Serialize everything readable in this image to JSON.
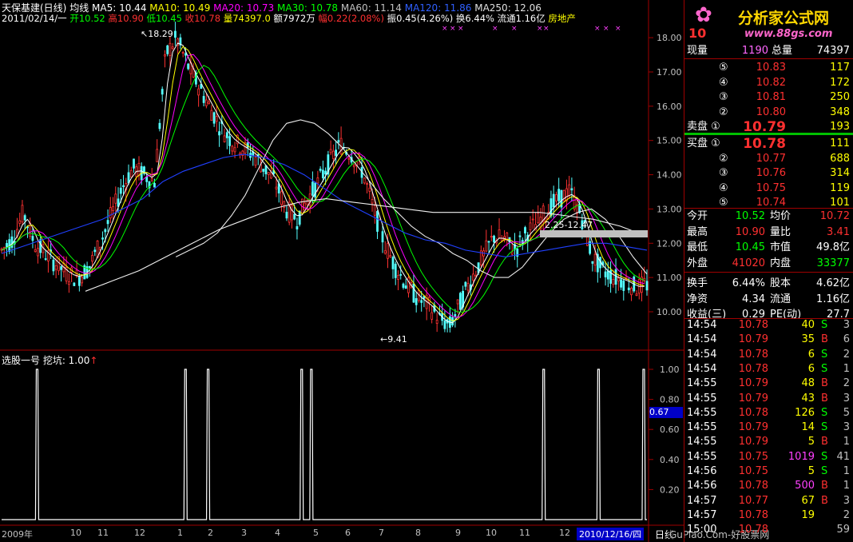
{
  "header": {
    "stock_title": "天保基建(日线)",
    "mode": "均线",
    "ma": [
      {
        "label": "MA5: 10.44",
        "color": "#ffffff"
      },
      {
        "label": "MA10: 10.49",
        "color": "#ffff00"
      },
      {
        "label": "MA20: 10.73",
        "color": "#ff00ff"
      },
      {
        "label": "MA30: 10.78",
        "color": "#00ff00"
      },
      {
        "label": "MA60: 11.14",
        "color": "#c0c0c0"
      },
      {
        "label": "MA120: 11.86",
        "color": "#3060ff"
      },
      {
        "label": "MA250: 12.06",
        "color": "#e0e0e0"
      }
    ],
    "line2": {
      "date": "2011/02/14/一",
      "open": "开10.52",
      "high": "高10.90",
      "low": "低10.45",
      "close": "收10.78",
      "volume": "量74397.0",
      "amount": "额7972万",
      "amp": "幅0.22(2.08%)",
      "swing": "振0.45(4.26%)",
      "turnover": "换6.44%",
      "float": "流通1.16亿",
      "sector": "房地产"
    }
  },
  "price_axis": {
    "ticks": [
      "18.00",
      "17.00",
      "16.00",
      "15.00",
      "14.00",
      "13.00",
      "12.00",
      "11.00",
      "10.00"
    ]
  },
  "annotations": {
    "high": "18.29",
    "low": "9.41",
    "range": "2.25-12.47"
  },
  "indicator": {
    "title": "选股一号 挖坑: 1.00",
    "value_tag": "0.67",
    "ticks": [
      "1.00",
      "0.80",
      "0.60",
      "0.40",
      "0.20"
    ]
  },
  "time_axis": {
    "labels": [
      "2009年",
      "10",
      "11",
      "12",
      "1",
      "2",
      "3",
      "4",
      "5",
      "6",
      "7",
      "8",
      "9",
      "10",
      "11",
      "12"
    ],
    "cursor_date": "2010/12/16/四",
    "period": "日线"
  },
  "watermark": {
    "site": "分析家公式网",
    "url": "www.88gs.com",
    "bottom": "GuPiao.Com-好股票网"
  },
  "chart_data": {
    "type": "line",
    "title": "天保基建(日线)",
    "ylim": [
      9.3,
      18.4
    ],
    "price_series": [
      11.8,
      12.1,
      12.9,
      12.0,
      11.7,
      11.4,
      11.1,
      11.0,
      11.3,
      12.0,
      12.8,
      13.6,
      14.2,
      14.0,
      13.8,
      17.5,
      18.0,
      17.2,
      16.6,
      16.0,
      15.4,
      15.0,
      14.8,
      14.6,
      14.2,
      13.8,
      13.0,
      12.7,
      13.3,
      13.8,
      14.4,
      14.9,
      14.6,
      14.1,
      13.0,
      12.0,
      11.3,
      10.8,
      10.4,
      10.2,
      9.8,
      9.6,
      10.3,
      11.0,
      11.6,
      12.2,
      12.1,
      11.8,
      12.3,
      12.6,
      13.0,
      13.3,
      13.5,
      12.8,
      11.6,
      11.2,
      11.0,
      10.9,
      10.7,
      10.8
    ],
    "ma_series": [
      {
        "name": "MA60",
        "values": [
          11.6,
          11.8,
          12.0,
          12.3,
          12.8,
          13.4,
          14.2,
          15.0,
          15.5,
          15.6,
          15.5,
          15.2,
          14.8,
          14.3,
          13.8,
          13.3,
          12.9,
          12.5,
          12.2,
          12.0,
          11.7,
          11.5,
          11.2,
          11.0,
          11.0,
          11.3,
          11.8,
          12.3,
          12.7,
          12.9,
          13.0,
          12.7,
          12.2,
          11.6,
          11.1
        ]
      },
      {
        "name": "MA120",
        "values": [
          11.7,
          11.9,
          12.1,
          12.3,
          12.5,
          12.7,
          13.0,
          13.3,
          13.8,
          14.1,
          14.3,
          14.5,
          14.6,
          14.5,
          14.3,
          14.0,
          13.6,
          13.2,
          12.9,
          12.6,
          12.3,
          12.1,
          12.0,
          11.8,
          11.7,
          11.6,
          11.7,
          11.8,
          11.9,
          12.0,
          12.0,
          11.9,
          11.8
        ]
      },
      {
        "name": "MA250",
        "values": [
          10.6,
          10.9,
          11.2,
          11.6,
          12.0,
          12.4,
          12.7,
          13.0,
          13.2,
          13.3,
          13.2,
          13.1,
          13.0,
          12.9,
          12.9,
          12.9,
          12.9,
          12.9,
          12.8,
          12.7,
          12.5,
          12.2
        ]
      }
    ],
    "signal_x": [
      0.055,
      0.285,
      0.32,
      0.465,
      0.48,
      0.84,
      0.925,
      0.995
    ],
    "signal_value": 1.0
  },
  "quote_panel": {
    "code_label": "10",
    "cur_vol": {
      "label": "现量",
      "value": "1190",
      "total_label": "总量",
      "total": "74397"
    },
    "asks": [
      {
        "lvl": "⑤",
        "price": "10.83",
        "vol": "117"
      },
      {
        "lvl": "④",
        "price": "10.82",
        "vol": "172"
      },
      {
        "lvl": "③",
        "price": "10.81",
        "vol": "250"
      },
      {
        "lvl": "②",
        "price": "10.80",
        "vol": "348"
      },
      {
        "lvl": "卖盘 ①",
        "price": "10.79",
        "vol": "193"
      }
    ],
    "bids": [
      {
        "lvl": "买盘 ①",
        "price": "10.78",
        "vol": "111"
      },
      {
        "lvl": "②",
        "price": "10.77",
        "vol": "688"
      },
      {
        "lvl": "③",
        "price": "10.76",
        "vol": "314"
      },
      {
        "lvl": "④",
        "price": "10.75",
        "vol": "119"
      },
      {
        "lvl": "⑤",
        "price": "10.74",
        "vol": "101"
      }
    ],
    "stats": [
      {
        "l1": "今开",
        "v1": "10.52",
        "c1": "#00ff00",
        "l2": "均价",
        "v2": "10.72",
        "c2": "#ff3030"
      },
      {
        "l1": "最高",
        "v1": "10.90",
        "c1": "#ff3030",
        "l2": "量比",
        "v2": "3.41",
        "c2": "#ff3030"
      },
      {
        "l1": "最低",
        "v1": "10.45",
        "c1": "#00ff00",
        "l2": "市值",
        "v2": "49.8亿",
        "c2": "#ffffff"
      },
      {
        "l1": "外盘",
        "v1": "41020",
        "c1": "#ff3030",
        "l2": "内盘",
        "v2": "33377",
        "c2": "#00ff00"
      },
      {
        "l1": "换手",
        "v1": "6.44%",
        "c1": "#ffffff",
        "l2": "股本",
        "v2": "4.62亿",
        "c2": "#ffffff"
      },
      {
        "l1": "净资",
        "v1": "4.34",
        "c1": "#ffffff",
        "l2": "流通",
        "v2": "1.16亿",
        "c2": "#ffffff"
      },
      {
        "l1": "收益(三)",
        "v1": "0.29",
        "c1": "#ffffff",
        "l2": "PE(动)",
        "v2": "27.7",
        "c2": "#ffffff"
      }
    ],
    "ticks": [
      {
        "t": "14:54",
        "p": "10.78",
        "v": "40",
        "bs": "S",
        "n": "3"
      },
      {
        "t": "14:54",
        "p": "10.79",
        "v": "35",
        "bs": "B",
        "n": "6"
      },
      {
        "t": "14:54",
        "p": "10.78",
        "v": "6",
        "bs": "S",
        "n": "2"
      },
      {
        "t": "14:54",
        "p": "10.78",
        "v": "6",
        "bs": "S",
        "n": "1"
      },
      {
        "t": "14:55",
        "p": "10.79",
        "v": "48",
        "bs": "B",
        "n": "2"
      },
      {
        "t": "14:55",
        "p": "10.79",
        "v": "43",
        "bs": "B",
        "n": "3"
      },
      {
        "t": "14:55",
        "p": "10.78",
        "v": "126",
        "bs": "S",
        "n": "5"
      },
      {
        "t": "14:55",
        "p": "10.79",
        "v": "14",
        "bs": "S",
        "n": "3"
      },
      {
        "t": "14:55",
        "p": "10.79",
        "v": "5",
        "bs": "B",
        "n": "1"
      },
      {
        "t": "14:55",
        "p": "10.75",
        "v": "1019",
        "bs": "S",
        "n": "41"
      },
      {
        "t": "14:56",
        "p": "10.75",
        "v": "5",
        "bs": "S",
        "n": "1"
      },
      {
        "t": "14:56",
        "p": "10.78",
        "v": "500",
        "bs": "B",
        "n": "1"
      },
      {
        "t": "14:57",
        "p": "10.77",
        "v": "67",
        "bs": "B",
        "n": "3"
      },
      {
        "t": "14:57",
        "p": "10.78",
        "v": "19",
        "bs": "",
        "n": "2"
      },
      {
        "t": "15:00",
        "p": "10.78",
        "v": "",
        "bs": "",
        "n": "59"
      }
    ]
  }
}
